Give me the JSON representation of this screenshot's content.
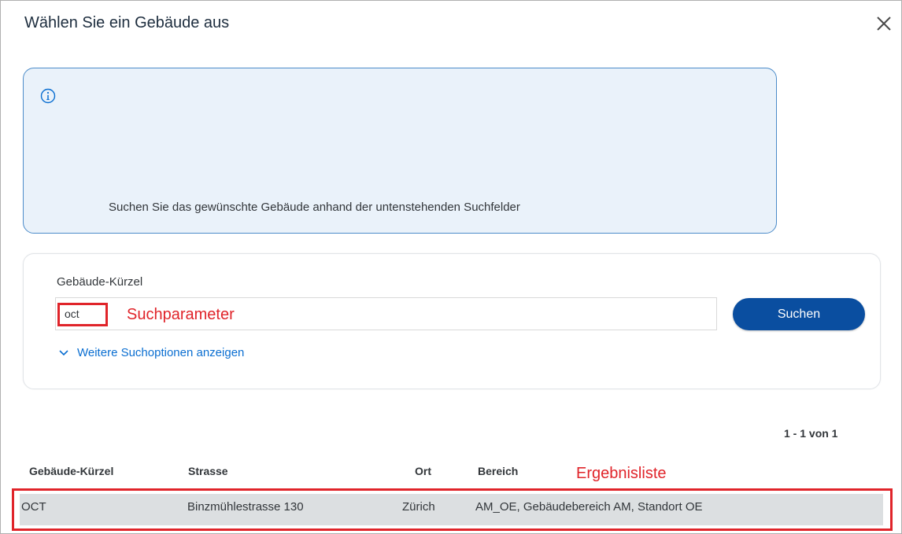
{
  "dialog": {
    "title": "Wählen Sie ein Gebäude aus",
    "close_icon": "close-icon"
  },
  "info": {
    "icon": "info-icon",
    "text": "Suchen Sie das gewünschte Gebäude anhand der untenstehenden Suchfelder",
    "accent_color": "#4b8bc9",
    "background": "#eaf2fa"
  },
  "search": {
    "field_label": "Gebäude-Kürzel",
    "value": "oct",
    "button_label": "Suchen",
    "button_color": "#0a4ea0",
    "more_options_label": "Weitere Suchoptionen anzeigen",
    "more_options_icon": "chevron-down-icon"
  },
  "annotations": {
    "search_param": "Suchparameter",
    "results": "Ergebnisliste",
    "color": "#e0242a"
  },
  "results": {
    "pager": "1 - 1 von 1",
    "columns": [
      "Gebäude-Kürzel",
      "Strasse",
      "Ort",
      "Bereich"
    ],
    "rows": [
      [
        "OCT",
        "Binzmühlestrasse 130",
        "Zürich",
        "AM_OE, Gebäudebereich AM, Standort OE"
      ]
    ]
  }
}
